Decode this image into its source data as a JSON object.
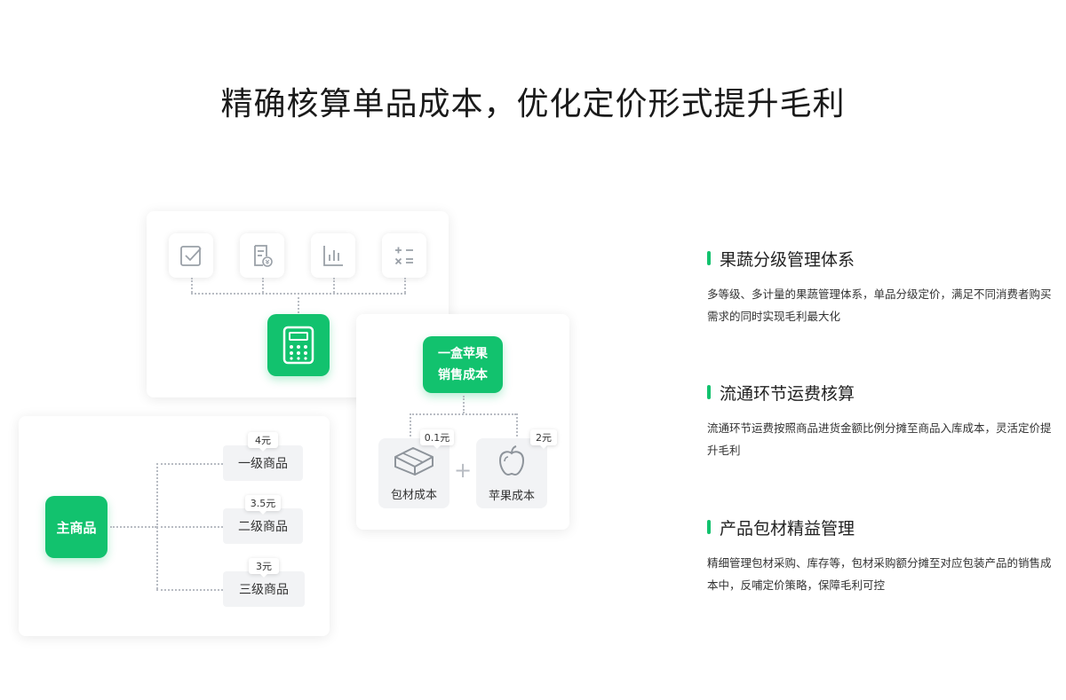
{
  "page": {
    "title": "精确核算单品成本，优化定价形式提升毛利"
  },
  "diagram": {
    "tool_icons": [
      "checkbox-icon",
      "invoice-icon",
      "bar-chart-icon",
      "calculator-operators-icon"
    ],
    "center_icon": "calculator-icon",
    "main_product": "主商品",
    "grades": [
      {
        "price": "4元",
        "label": "一级商品"
      },
      {
        "price": "3.5元",
        "label": "二级商品"
      },
      {
        "price": "3元",
        "label": "三级商品"
      }
    ],
    "box_cost": {
      "line1": "一盒苹果",
      "line2": "销售成本",
      "items": [
        {
          "price": "0.1元",
          "label": "包材成本",
          "icon": "package-box-icon"
        },
        {
          "price": "2元",
          "label": "苹果成本",
          "icon": "apple-icon"
        }
      ],
      "plus": "+"
    }
  },
  "features": [
    {
      "title": "果蔬分级管理体系",
      "desc": "多等级、多计量的果蔬管理体系，单品分级定价，满足不同消费者购买需求的同时实现毛利最大化"
    },
    {
      "title": "流通环节运费核算",
      "desc": "流通环节运费按照商品进货金额比例分摊至商品入库成本，灵活定价提升毛利"
    },
    {
      "title": "产品包材精益管理",
      "desc": "精细管理包材采购、库存等，包材采购额分摊至对应包装产品的销售成本中，反哺定价策略，保障毛利可控"
    }
  ],
  "colors": {
    "accent": "#12c26e",
    "tile": "#f2f3f5"
  }
}
